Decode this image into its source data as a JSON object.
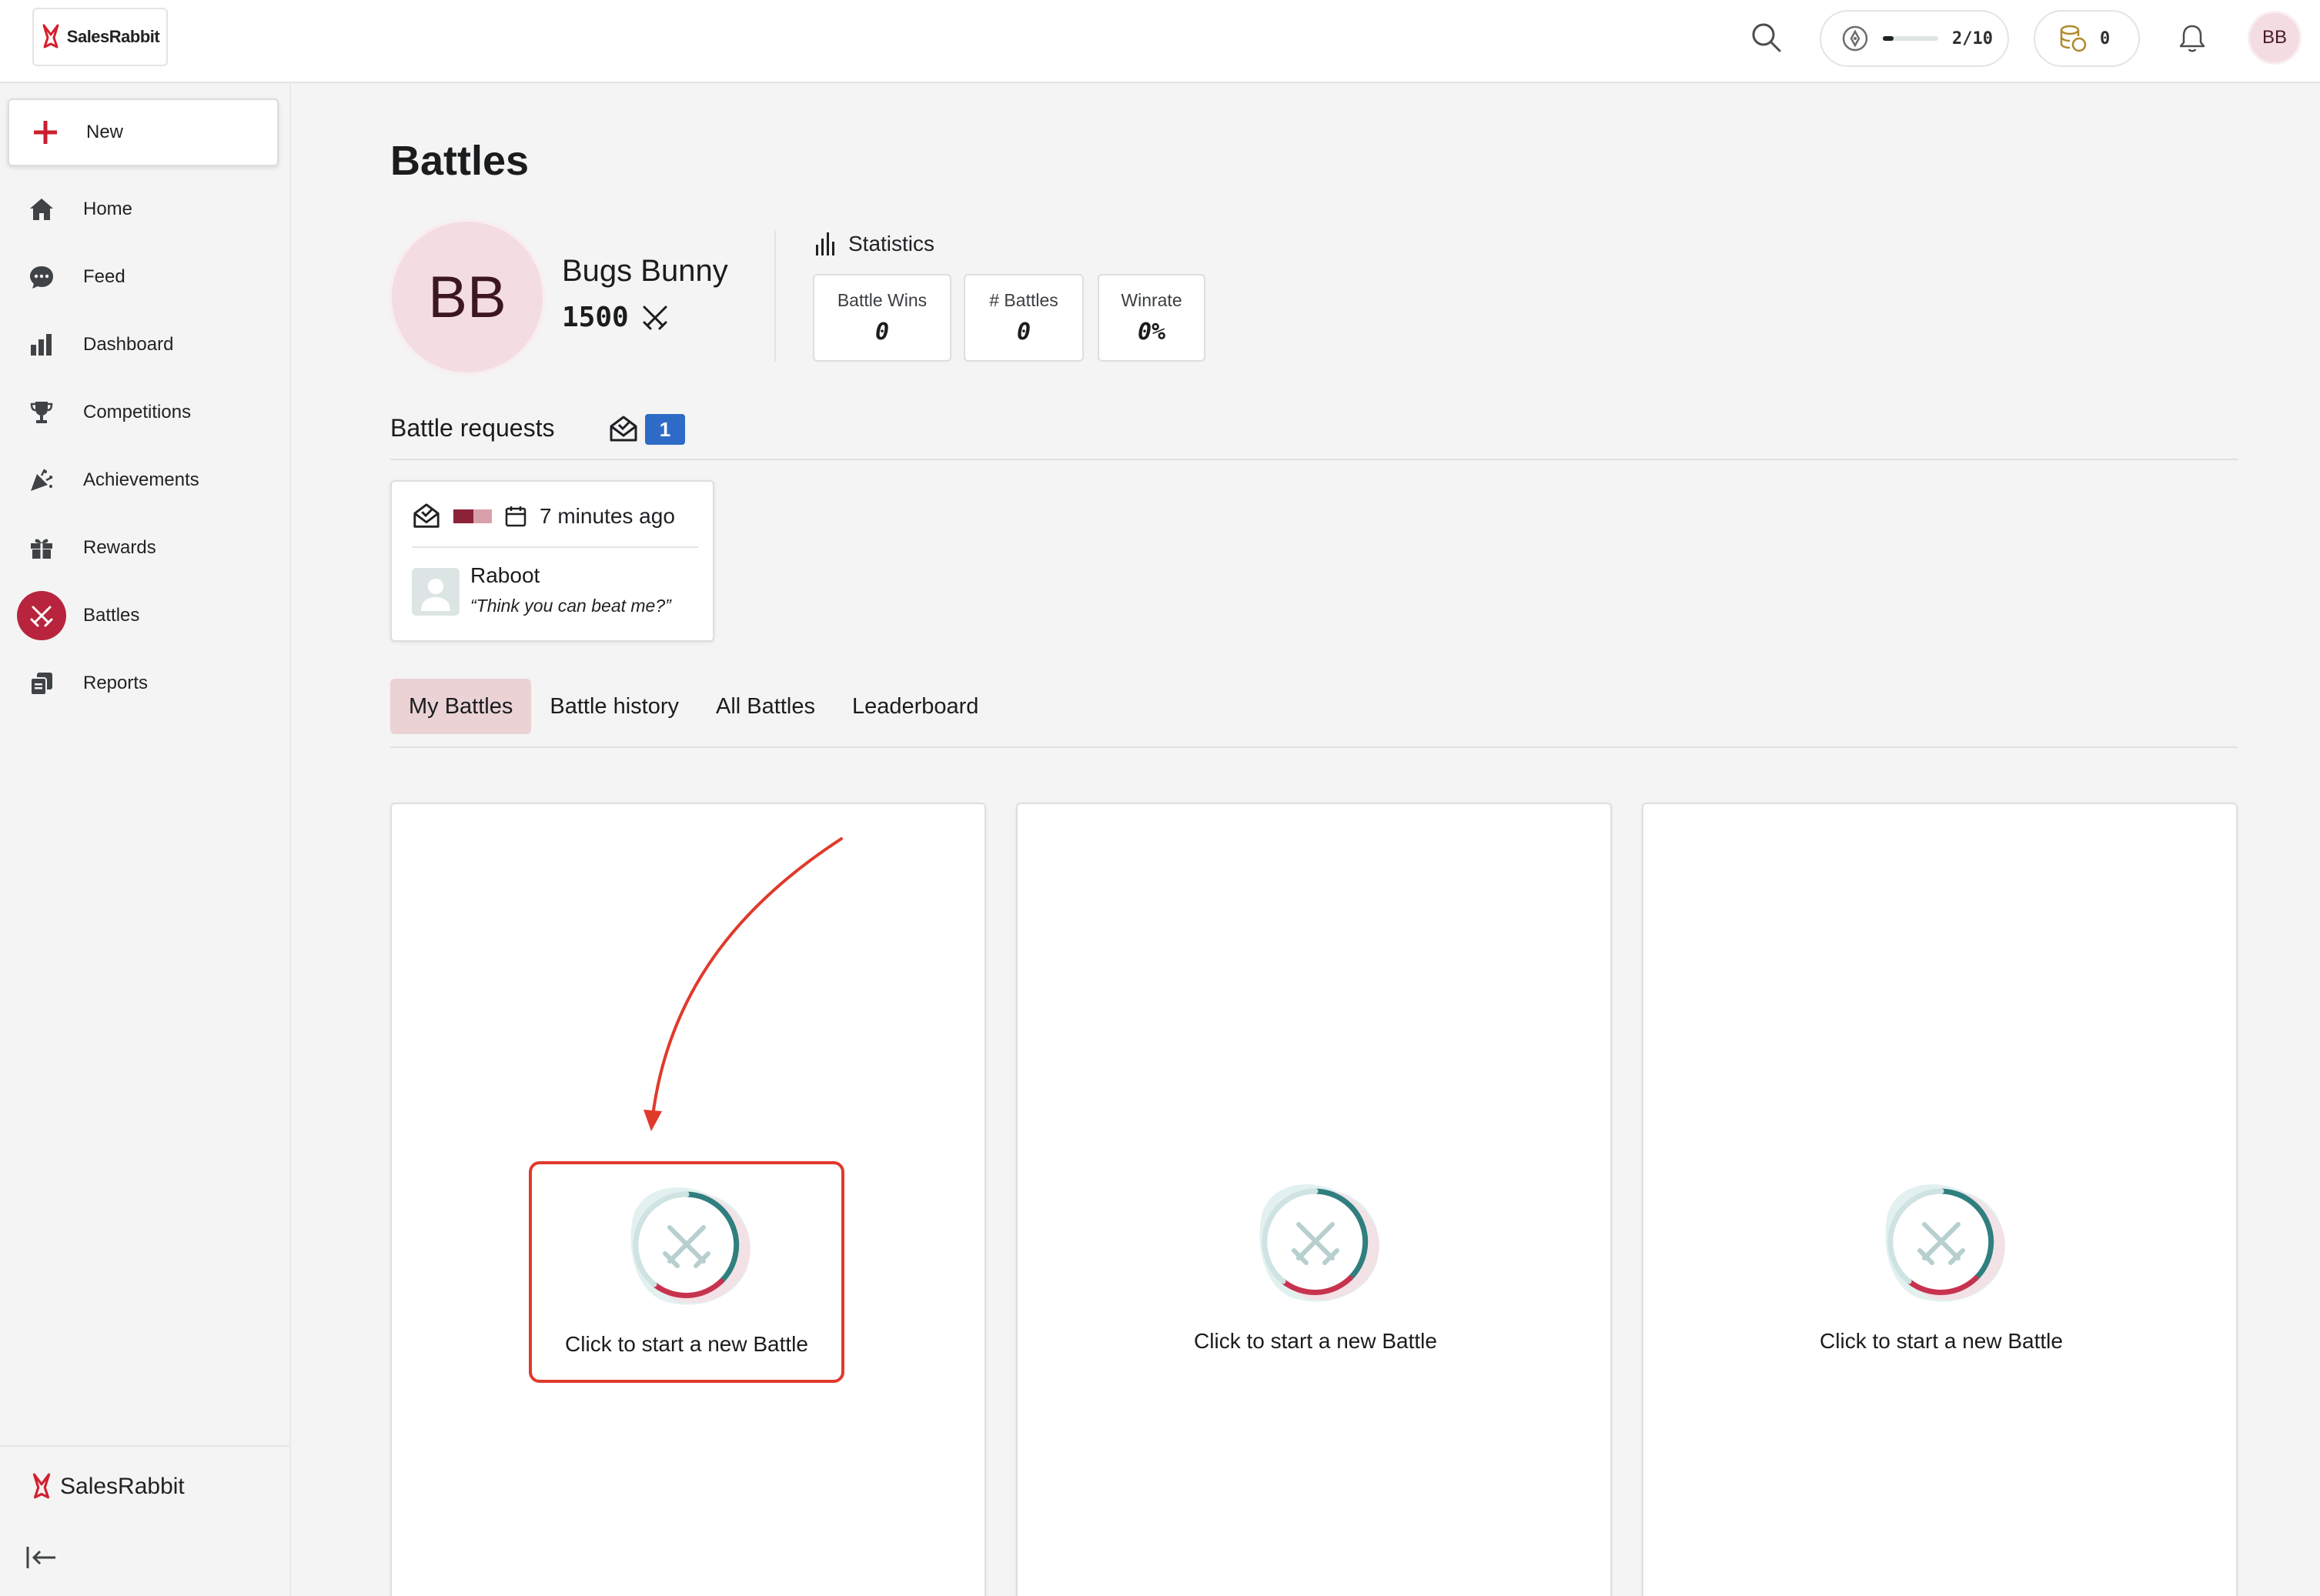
{
  "brand": {
    "name": "SalesRabbit"
  },
  "topbar": {
    "progress_text": "2/10",
    "progress_fraction": 0.2,
    "coins": "0",
    "avatar_initials": "BB"
  },
  "sidebar": {
    "new_label": "New",
    "items": [
      {
        "label": "Home",
        "icon": "home-icon"
      },
      {
        "label": "Feed",
        "icon": "chat-bubble-icon"
      },
      {
        "label": "Dashboard",
        "icon": "bar-chart-icon"
      },
      {
        "label": "Competitions",
        "icon": "trophy-icon"
      },
      {
        "label": "Achievements",
        "icon": "party-popper-icon"
      },
      {
        "label": "Rewards",
        "icon": "gift-icon"
      },
      {
        "label": "Battles",
        "icon": "crossed-swords-icon",
        "active": true
      },
      {
        "label": "Reports",
        "icon": "reports-icon"
      }
    ],
    "footer_brand": "SalesRabbit"
  },
  "page": {
    "title": "Battles",
    "profile": {
      "initials": "BB",
      "name": "Bugs Bunny",
      "score": "1500"
    },
    "statistics": {
      "heading": "Statistics",
      "cards": [
        {
          "label": "Battle Wins",
          "value": "0"
        },
        {
          "label": "# Battles",
          "value": "0"
        },
        {
          "label": "Winrate",
          "value": "0%"
        }
      ]
    },
    "requests": {
      "heading": "Battle requests",
      "count": "1",
      "items": [
        {
          "time": "7 minutes ago",
          "sender": "Raboot",
          "message": "“Think you can beat me?”"
        }
      ]
    },
    "tabs": [
      {
        "label": "My Battles",
        "active": true
      },
      {
        "label": "Battle history"
      },
      {
        "label": "All Battles"
      },
      {
        "label": "Leaderboard"
      }
    ],
    "battle_slots": [
      {
        "label": "Click to start a new Battle"
      },
      {
        "label": "Click to start a new Battle"
      },
      {
        "label": "Click to start a new Battle"
      }
    ]
  },
  "colors": {
    "accent": "#b8243d",
    "badge_blue": "#2e6bc6",
    "annotation_red": "#e03a2b",
    "active_tab_bg": "#ead2d5"
  }
}
